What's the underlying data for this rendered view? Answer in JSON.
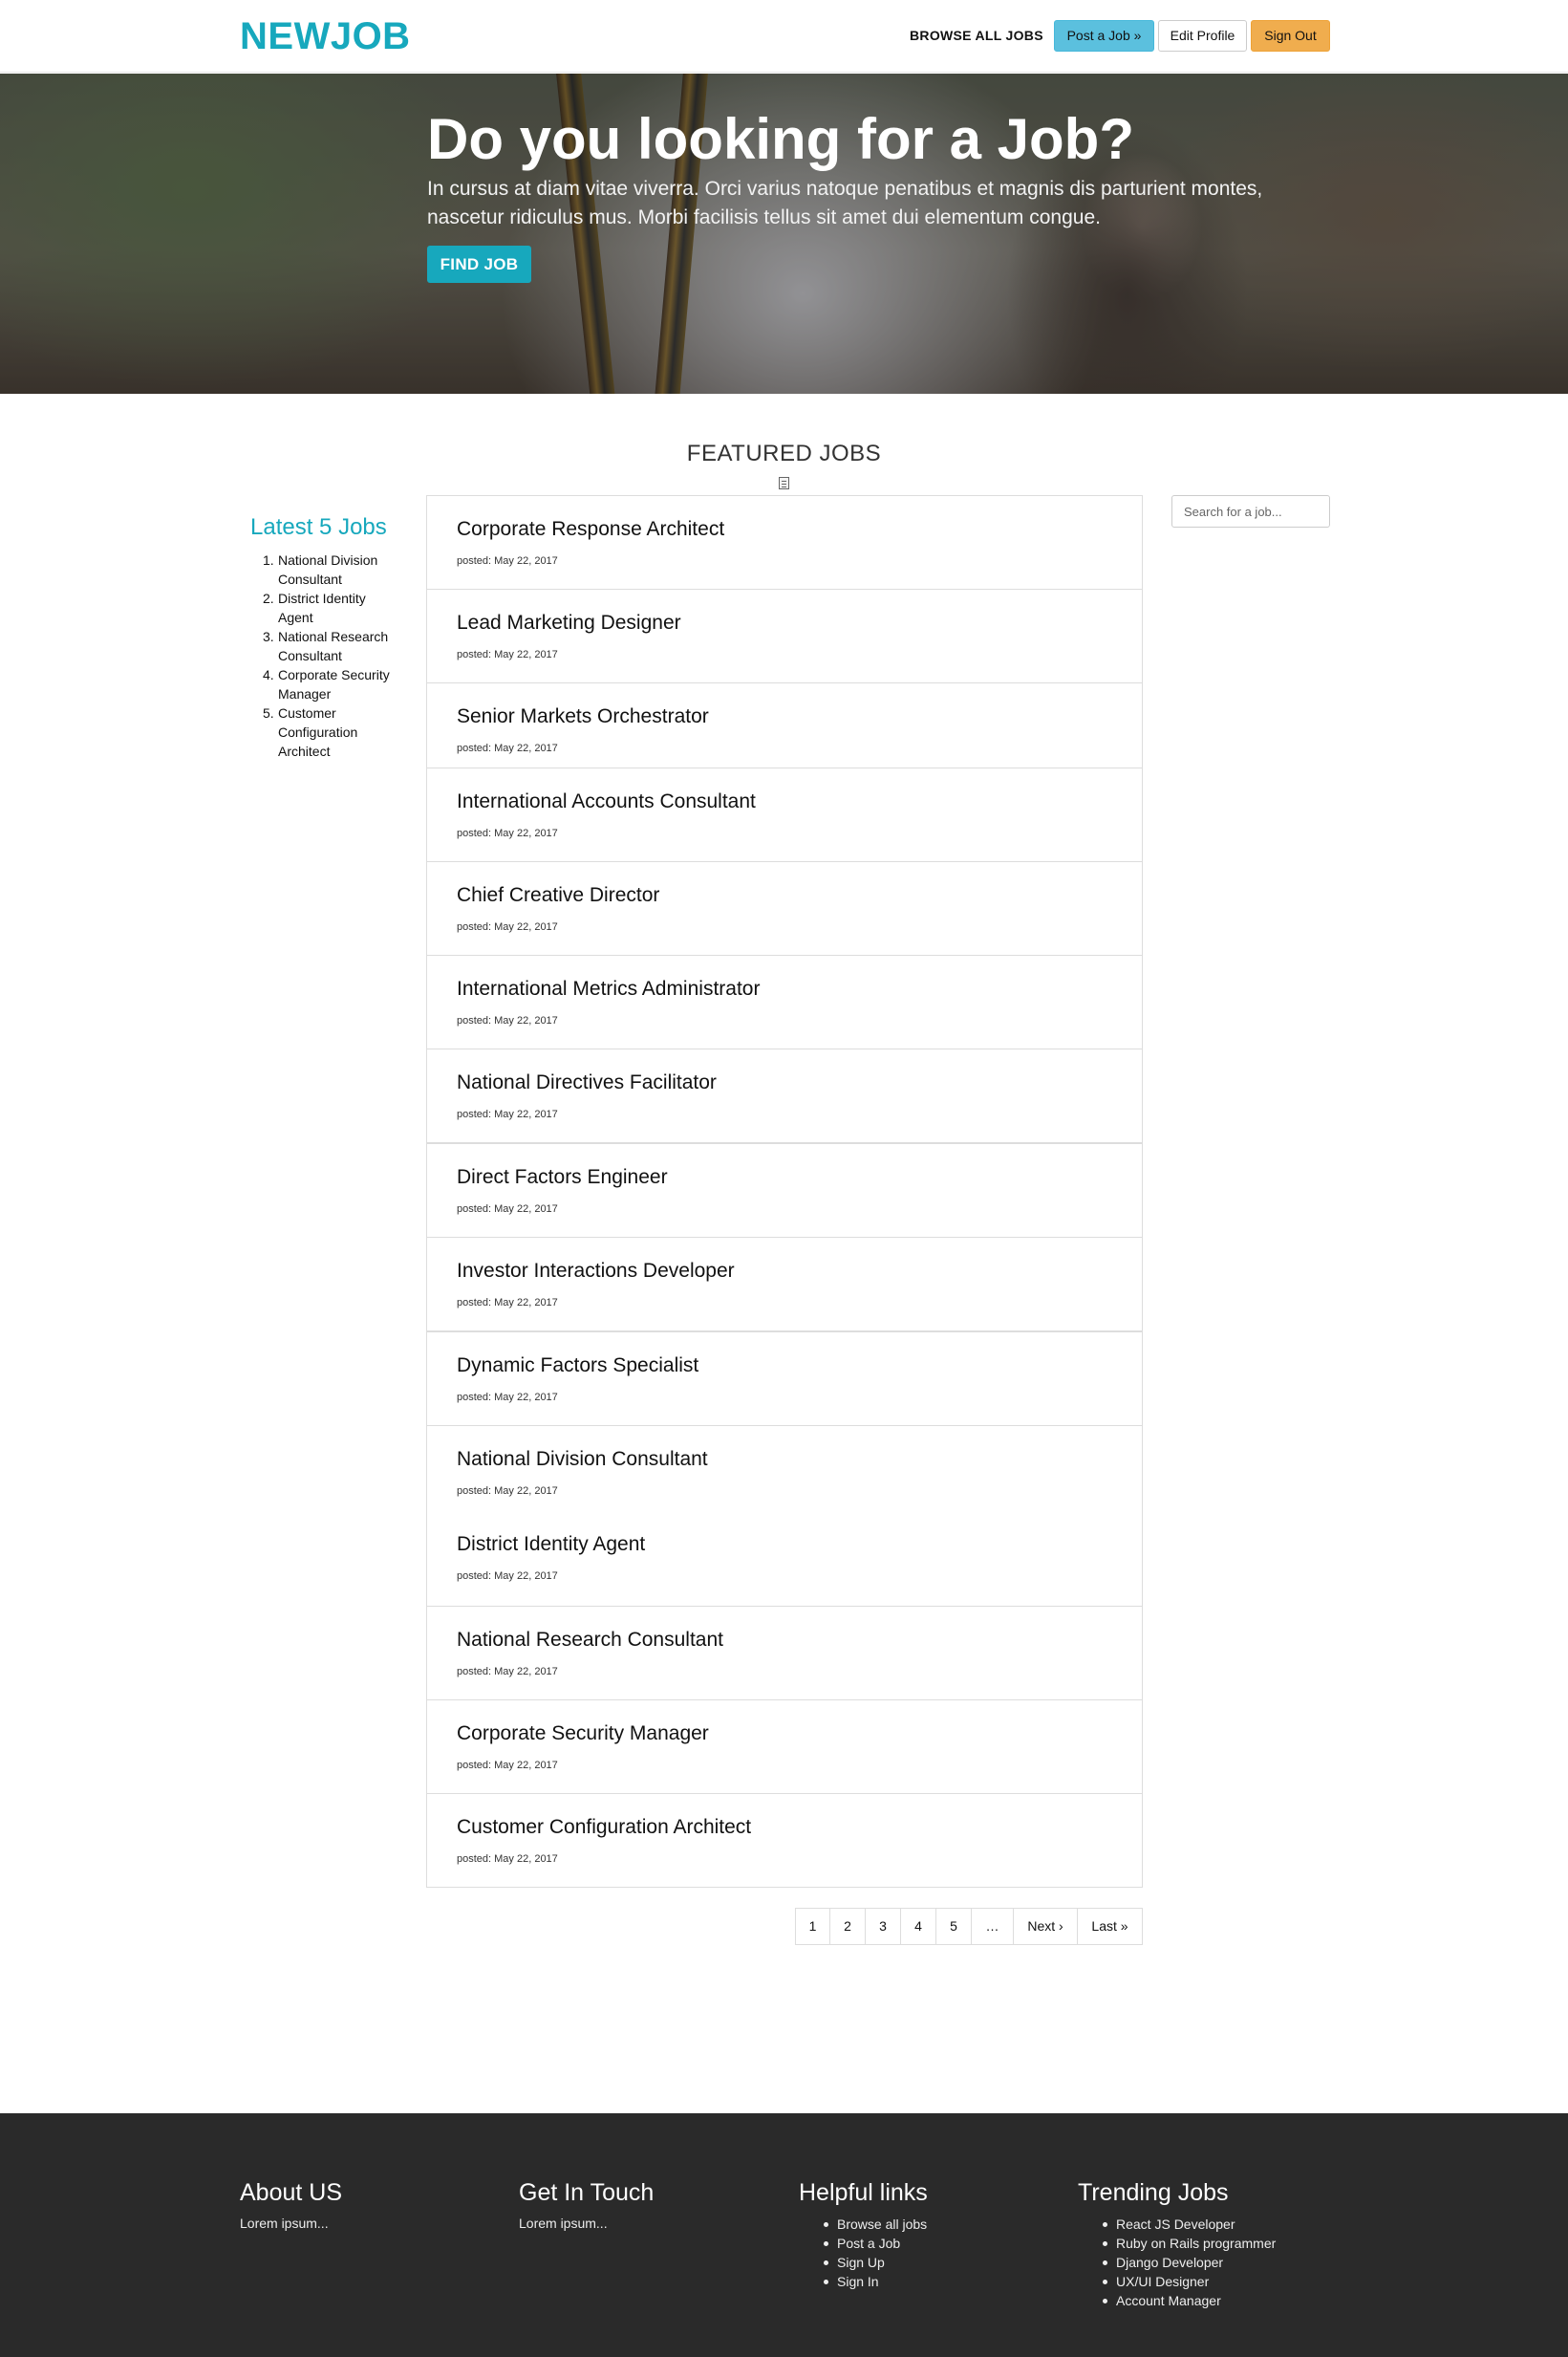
{
  "navbar": {
    "brand": "NEWJOB",
    "browse_label": "BROWSE ALL JOBS",
    "post_job_label": "Post a Job »",
    "edit_profile_label": "Edit Profile",
    "sign_out_label": "Sign Out"
  },
  "hero": {
    "title": "Do you looking for a Job?",
    "text": "In cursus at diam vitae viverra. Orci varius natoque penatibus et magnis dis parturient montes, nascetur ridiculus mus. Morbi facilisis tellus sit amet dui elementum congue.",
    "button_label": "FIND JOB"
  },
  "featured": {
    "title": "FEATURED JOBS"
  },
  "latest": {
    "title": "Latest 5 Jobs",
    "items": [
      {
        "num": "1.",
        "label": "National Division Consultant"
      },
      {
        "num": "2.",
        "label": "District Identity Agent"
      },
      {
        "num": "3.",
        "label": "National Research Consultant"
      },
      {
        "num": "4.",
        "label": "Corporate Security Manager"
      },
      {
        "num": "5.",
        "label": "Customer Configuration Architect"
      }
    ]
  },
  "search": {
    "placeholder": "Search for a job..."
  },
  "jobs": [
    {
      "title": "Corporate Response Architect",
      "posted": "posted: May 22, 2017"
    },
    {
      "title": "Lead Marketing Designer",
      "posted": "posted: May 22, 2017"
    },
    {
      "title": "Senior Markets Orchestrator",
      "posted": "posted: May 22, 2017"
    },
    {
      "title": "International Accounts Consultant",
      "posted": "posted: May 22, 2017"
    },
    {
      "title": "Chief Creative Director",
      "posted": "posted: May 22, 2017"
    },
    {
      "title": "International Metrics Administrator",
      "posted": "posted: May 22, 2017"
    },
    {
      "title": "National Directives Facilitator",
      "posted": "posted: May 22, 2017"
    },
    {
      "title": "Direct Factors Engineer",
      "posted": "posted: May 22, 2017"
    },
    {
      "title": "Investor Interactions Developer",
      "posted": "posted: May 22, 2017"
    },
    {
      "title": "Dynamic Factors Specialist",
      "posted": "posted: May 22, 2017"
    },
    {
      "title": "National Division Consultant",
      "posted": "posted: May 22, 2017"
    },
    {
      "title": "District Identity Agent",
      "posted": "posted: May 22, 2017"
    },
    {
      "title": "National Research Consultant",
      "posted": "posted: May 22, 2017"
    },
    {
      "title": "Corporate Security Manager",
      "posted": "posted: May 22, 2017"
    },
    {
      "title": "Customer Configuration Architect",
      "posted": "posted: May 22, 2017"
    }
  ],
  "pagination": [
    "1",
    "2",
    "3",
    "4",
    "5",
    "…",
    "Next ›",
    "Last »"
  ],
  "footer": {
    "about": {
      "title": "About US",
      "text": "Lorem ipsum..."
    },
    "contact": {
      "title": "Get In Touch",
      "text": "Lorem ipsum..."
    },
    "helpful": {
      "title": "Helpful links",
      "items": [
        "Browse all jobs",
        "Post a Job",
        "Sign Up",
        "Sign In"
      ]
    },
    "trending": {
      "title": "Trending Jobs",
      "items": [
        "React JS Developer",
        "Ruby on Rails programmer",
        "Django Developer",
        "UX/UI Designer",
        "Account Manager"
      ]
    }
  },
  "colors": {
    "brand": "#17a8bd",
    "info": "#5bc0de",
    "warning": "#f0ad4e",
    "footer_bg": "#2a2a2a"
  }
}
